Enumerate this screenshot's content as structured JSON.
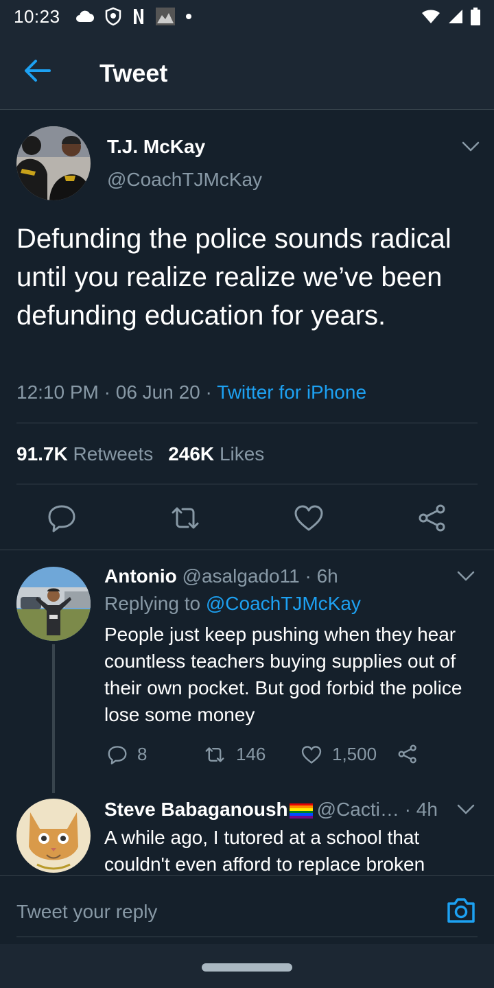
{
  "status_bar": {
    "time": "10:23"
  },
  "header": {
    "title": "Tweet"
  },
  "main_tweet": {
    "author_name": "T.J. McKay",
    "author_handle": "@CoachTJMcKay",
    "text": "Defunding the police sounds radical until you realize realize we’ve been defunding education for years.",
    "time": "12:10 PM",
    "date": "06 Jun 20",
    "separator": " · ",
    "source": "Twitter for iPhone",
    "retweets_count": "91.7K",
    "retweets_label": "Retweets",
    "likes_count": "246K",
    "likes_label": "Likes"
  },
  "replies": [
    {
      "name": "Antonio",
      "handle": "@asalgado11",
      "time": "6h",
      "dot": "·",
      "replying_prefix": "Replying to",
      "replying_to": "@CoachTJMcKay",
      "text": "People just keep pushing when they hear countless teachers buying supplies out of their own pocket. But god forbid the police lose some money",
      "reply_count": "8",
      "retweet_count": "146",
      "like_count": "1,500"
    },
    {
      "name": "Steve Babaganoush",
      "handle": "@Cacti…",
      "time": "4h",
      "dot": "·",
      "text": "A while ago, I tutored at a school that couldn't even afford to replace broken"
    }
  ],
  "reply_box": {
    "placeholder": "Tweet your reply"
  },
  "colors": {
    "background": "#15202b",
    "accent": "#1da1f2",
    "secondary_text": "#8899a6"
  },
  "icons": [
    "back-arrow-icon",
    "chevron-down-icon",
    "reply-icon",
    "retweet-icon",
    "like-icon",
    "share-icon",
    "camera-icon",
    "rainbow-flag-icon"
  ]
}
